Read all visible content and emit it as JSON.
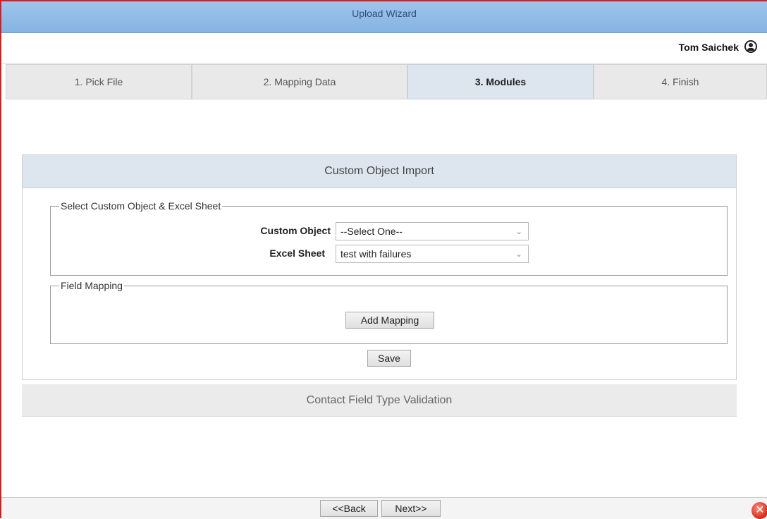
{
  "window": {
    "title": "Upload Wizard"
  },
  "user": {
    "name": "Tom Saichek",
    "icon": "user-circle-icon"
  },
  "tabs": [
    {
      "label": "1. Pick File",
      "active": false
    },
    {
      "label": "2. Mapping Data",
      "active": false
    },
    {
      "label": "3. Modules",
      "active": true
    },
    {
      "label": "4. Finish",
      "active": false
    }
  ],
  "custom_object_import": {
    "header": "Custom Object Import",
    "select_group": {
      "legend": "Select Custom Object & Excel Sheet",
      "custom_object": {
        "label": "Custom Object",
        "value": "--Select One--"
      },
      "excel_sheet": {
        "label": "Excel Sheet",
        "value": "test with failures"
      }
    },
    "field_mapping": {
      "legend": "Field Mapping",
      "add_button": "Add Mapping"
    },
    "save_button": "Save"
  },
  "contact_validation": {
    "header": "Contact Field Type Validation"
  },
  "footer": {
    "back_button": "<<Back",
    "next_button": "Next>>",
    "close_icon": "close-icon"
  },
  "colors": {
    "titlebar": "#8fbbe7",
    "active_tab": "#dde6ee",
    "frame_border": "#d62020"
  }
}
